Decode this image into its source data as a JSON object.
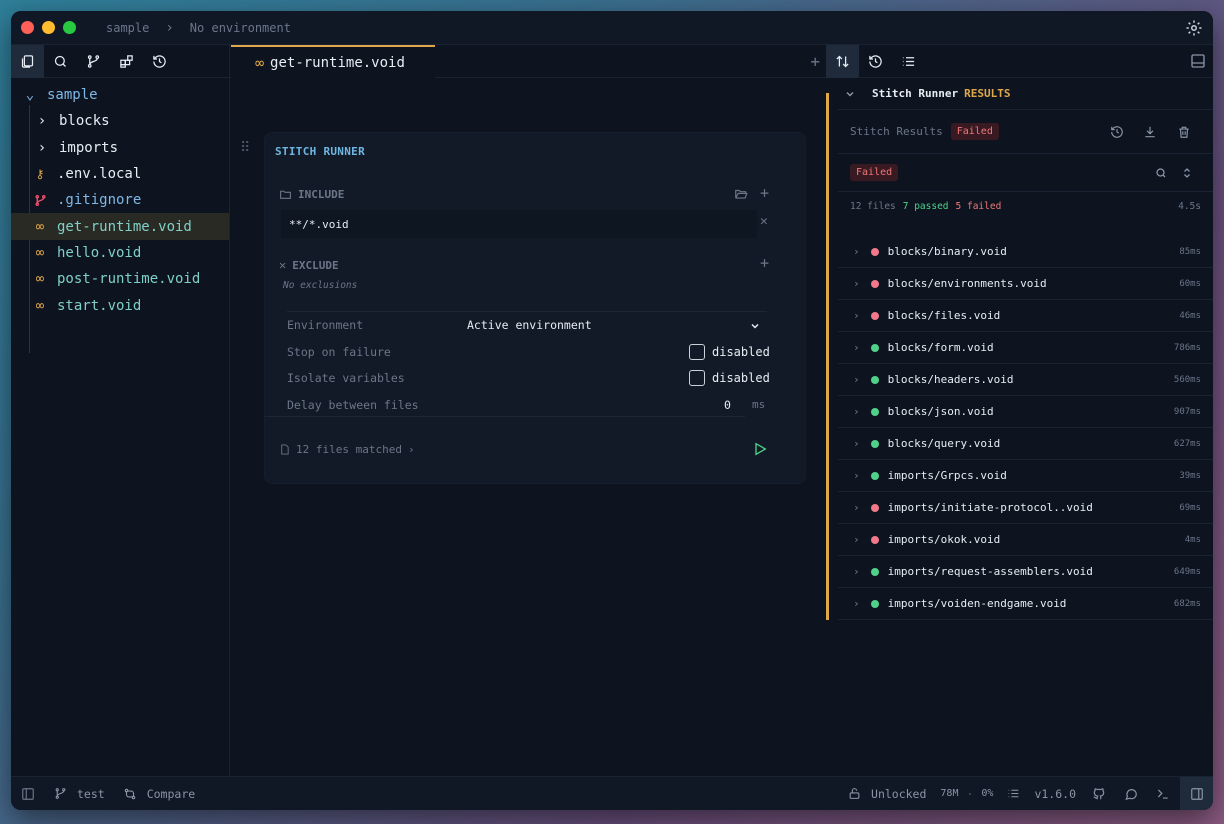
{
  "titlebar": {
    "project": "sample",
    "environment": "No environment"
  },
  "sidebar": {
    "root": "sample",
    "items": [
      {
        "label": "blocks",
        "type": "folder"
      },
      {
        "label": "imports",
        "type": "folder"
      },
      {
        "label": ".env.local",
        "type": "env"
      },
      {
        "label": ".gitignore",
        "type": "git"
      },
      {
        "label": "get-runtime.void",
        "type": "void",
        "selected": true
      },
      {
        "label": "hello.void",
        "type": "void"
      },
      {
        "label": "post-runtime.void",
        "type": "void"
      },
      {
        "label": "start.void",
        "type": "void"
      }
    ]
  },
  "editor": {
    "tab_label": "get-runtime.void",
    "card_title": "STITCH RUNNER",
    "include_label": "INCLUDE",
    "include_pattern": "**/*.void",
    "exclude_label": "EXCLUDE",
    "no_exclusions": "No exclusions",
    "settings": {
      "environment_label": "Environment",
      "environment_value": "Active environment",
      "stop_label": "Stop on failure",
      "stop_value": "disabled",
      "isolate_label": "Isolate variables",
      "isolate_value": "disabled",
      "delay_label": "Delay between files",
      "delay_value": "0",
      "delay_unit": "ms"
    },
    "files_matched": "12 files matched"
  },
  "results": {
    "header_title": "Stitch Runner",
    "header_results": "RESULTS",
    "stitch_results_label": "Stitch Results",
    "status_badge": "Failed",
    "filter_badge": "Failed",
    "summary_files": "12 files",
    "summary_passed": "7 passed",
    "summary_failed": "5 failed",
    "summary_time": "4.5s",
    "colors": {
      "pass": "#4fd18b",
      "fail": "#f07888"
    },
    "rows": [
      {
        "name": "blocks/binary.void",
        "status": "fail",
        "duration": "85ms"
      },
      {
        "name": "blocks/environments.void",
        "status": "fail",
        "duration": "60ms"
      },
      {
        "name": "blocks/files.void",
        "status": "fail",
        "duration": "46ms"
      },
      {
        "name": "blocks/form.void",
        "status": "pass",
        "duration": "786ms"
      },
      {
        "name": "blocks/headers.void",
        "status": "pass",
        "duration": "560ms"
      },
      {
        "name": "blocks/json.void",
        "status": "pass",
        "duration": "907ms"
      },
      {
        "name": "blocks/query.void",
        "status": "pass",
        "duration": "627ms"
      },
      {
        "name": "imports/Grpcs.void",
        "status": "pass",
        "duration": "39ms"
      },
      {
        "name": "imports/initiate-protocol..void",
        "status": "fail",
        "duration": "69ms"
      },
      {
        "name": "imports/okok.void",
        "status": "fail",
        "duration": "4ms"
      },
      {
        "name": "imports/request-assemblers.void",
        "status": "pass",
        "duration": "649ms"
      },
      {
        "name": "imports/voiden-endgame.void",
        "status": "pass",
        "duration": "682ms"
      }
    ]
  },
  "statusbar": {
    "branch": "test",
    "compare": "Compare",
    "lock": "Unlocked",
    "memory": "78M",
    "cpu": "0%",
    "version": "v1.6.0"
  }
}
